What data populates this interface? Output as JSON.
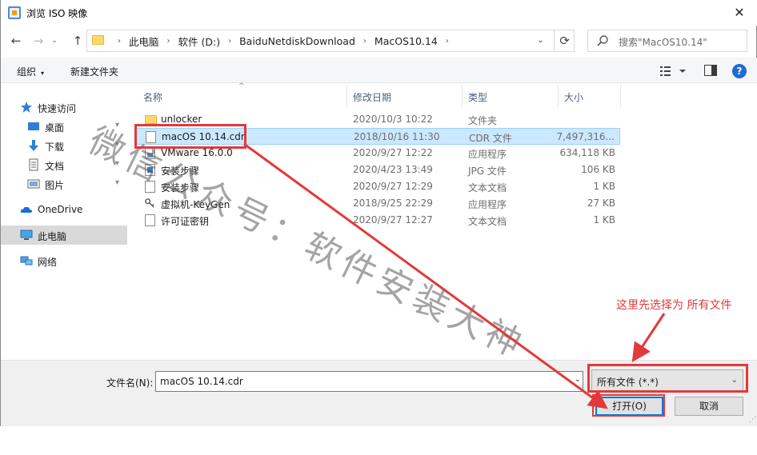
{
  "window": {
    "title": "浏览 ISO 映像",
    "close_glyph": "✕"
  },
  "navigation": {
    "back_glyph": "←",
    "forward_glyph": "→",
    "recent_glyph": "⌄",
    "up_glyph": "↑",
    "breadcrumbs": [
      "此电脑",
      "软件 (D:)",
      "BaiduNetdiskDownload",
      "MacOS10.14"
    ],
    "breadcrumb_separator": "›",
    "refresh_glyph": "⟳",
    "search_placeholder": "搜索\"MacOS10.14\""
  },
  "toolbar": {
    "organize_label": "组织",
    "organize_caret": "▾",
    "new_folder_label": "新建文件夹",
    "help_glyph": "?"
  },
  "sidebar": {
    "items": [
      {
        "label": "快速访问",
        "icon": "star-icon"
      },
      {
        "label": "桌面",
        "icon": "desktop-icon",
        "pinned": true
      },
      {
        "label": "下载",
        "icon": "download-icon",
        "pinned": true
      },
      {
        "label": "文档",
        "icon": "document-icon",
        "pinned": true
      },
      {
        "label": "图片",
        "icon": "picture-icon",
        "pinned": true
      },
      {
        "label": "OneDrive",
        "icon": "cloud-icon"
      },
      {
        "label": "此电脑",
        "icon": "computer-icon",
        "selected": true
      },
      {
        "label": "网络",
        "icon": "network-icon"
      }
    ],
    "pin_glyph": "📌"
  },
  "file_list": {
    "columns": {
      "name": "名称",
      "date": "修改日期",
      "type": "类型",
      "size": "大小"
    },
    "sort_caret": "^",
    "rows": [
      {
        "name": "unlocker",
        "date": "2020/10/3 10:22",
        "type": "文件夹",
        "size": "",
        "icon": "folder-icon"
      },
      {
        "name": "macOS 10.14.cdr",
        "date": "2018/10/16 11:30",
        "type": "CDR 文件",
        "size": "7,497,316...",
        "icon": "file-icon",
        "selected": true
      },
      {
        "name": "VMware 16.0.0",
        "date": "2020/9/27 12:22",
        "type": "应用程序",
        "size": "634,118 KB",
        "icon": "installer-icon"
      },
      {
        "name": "安装步骤",
        "date": "2020/4/23 13:49",
        "type": "JPG 文件",
        "size": "106 KB",
        "icon": "image-file-icon"
      },
      {
        "name": "安装步骤",
        "date": "2020/9/27 12:29",
        "type": "文本文档",
        "size": "1 KB",
        "icon": "text-file-icon"
      },
      {
        "name": "虚拟机-KeyGen",
        "date": "2018/9/25 22:29",
        "type": "应用程序",
        "size": "27 KB",
        "icon": "key-icon"
      },
      {
        "name": "许可证密钥",
        "date": "2020/9/27 12:27",
        "type": "文本文档",
        "size": "1 KB",
        "icon": "text-file-icon"
      }
    ]
  },
  "footer": {
    "filename_label": "文件名(N):",
    "filename_value": "macOS 10.14.cdr",
    "filetype_value": "所有文件 (*.*)",
    "open_button": "打开(O)",
    "cancel_button": "取消",
    "dropdown_caret": "⌄"
  },
  "annotations": {
    "instruction": "这里先选择为 所有文件",
    "watermark": "微信公众号：软件安装大神",
    "color": "#e23a3a"
  }
}
